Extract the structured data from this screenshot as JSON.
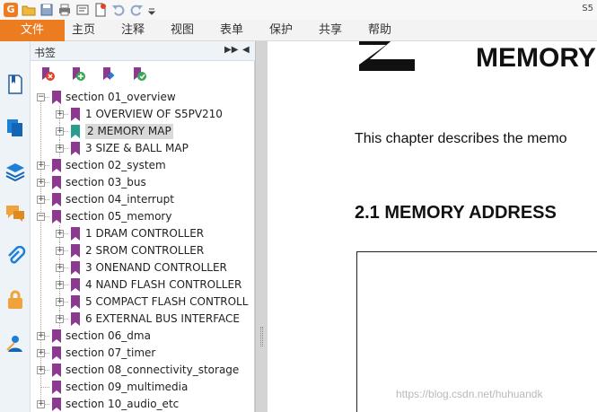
{
  "window": {
    "title": "S5"
  },
  "menu": {
    "tabs": [
      "文件",
      "主页",
      "注释",
      "视图",
      "表单",
      "保护",
      "共享",
      "帮助"
    ]
  },
  "panel": {
    "title": "书签",
    "tree": [
      {
        "label": "section 01_overview",
        "level": 0,
        "expanded": true,
        "color": "#8b3a8f"
      },
      {
        "label": "1 OVERVIEW OF S5PV210",
        "level": 1,
        "expanded": false,
        "color": "#8b3a8f"
      },
      {
        "label": "2 MEMORY MAP",
        "level": 1,
        "expanded": false,
        "color": "#2a9d8f",
        "selected": true
      },
      {
        "label": "3 SIZE & BALL MAP",
        "level": 1,
        "expanded": false,
        "color": "#8b3a8f"
      },
      {
        "label": "section 02_system",
        "level": 0,
        "expanded": false,
        "color": "#8b3a8f"
      },
      {
        "label": "section 03_bus",
        "level": 0,
        "expanded": false,
        "color": "#8b3a8f"
      },
      {
        "label": "section 04_interrupt",
        "level": 0,
        "expanded": false,
        "color": "#8b3a8f"
      },
      {
        "label": "section 05_memory",
        "level": 0,
        "expanded": true,
        "color": "#8b3a8f"
      },
      {
        "label": "1 DRAM CONTROLLER",
        "level": 1,
        "expanded": false,
        "color": "#8b3a8f"
      },
      {
        "label": "2 SROM CONTROLLER",
        "level": 1,
        "expanded": false,
        "color": "#8b3a8f"
      },
      {
        "label": "3 ONENAND CONTROLLER",
        "level": 1,
        "expanded": false,
        "color": "#8b3a8f"
      },
      {
        "label": "4 NAND FLASH CONTROLLER",
        "level": 1,
        "expanded": false,
        "color": "#8b3a8f"
      },
      {
        "label": "5 COMPACT FLASH CONTROLL",
        "level": 1,
        "expanded": false,
        "color": "#8b3a8f"
      },
      {
        "label": "6 EXTERNAL BUS INTERFACE",
        "level": 1,
        "expanded": false,
        "color": "#8b3a8f"
      },
      {
        "label": "section 06_dma",
        "level": 0,
        "expanded": false,
        "color": "#8b3a8f"
      },
      {
        "label": "section 07_timer",
        "level": 0,
        "expanded": false,
        "color": "#8b3a8f"
      },
      {
        "label": "section 08_connectivity_storage",
        "level": 0,
        "expanded": false,
        "color": "#8b3a8f"
      },
      {
        "label": "section 09_multimedia",
        "level": 0,
        "expanded": null,
        "color": "#8b3a8f"
      },
      {
        "label": "section 10_audio_etc",
        "level": 0,
        "expanded": false,
        "color": "#8b3a8f"
      }
    ]
  },
  "document": {
    "chapter_title": "MEMORY",
    "intro_text": "This chapter describes the memo",
    "section_heading": "2.1  MEMORY ADDRESS"
  },
  "watermark": "https://blog.csdn.net/huhuandk",
  "colors": {
    "accent": "#ec7c20",
    "bookmark": "#8b3a8f",
    "bookmark_selected": "#2a9d8f",
    "sidebar_icon": "#1e7fd6"
  }
}
